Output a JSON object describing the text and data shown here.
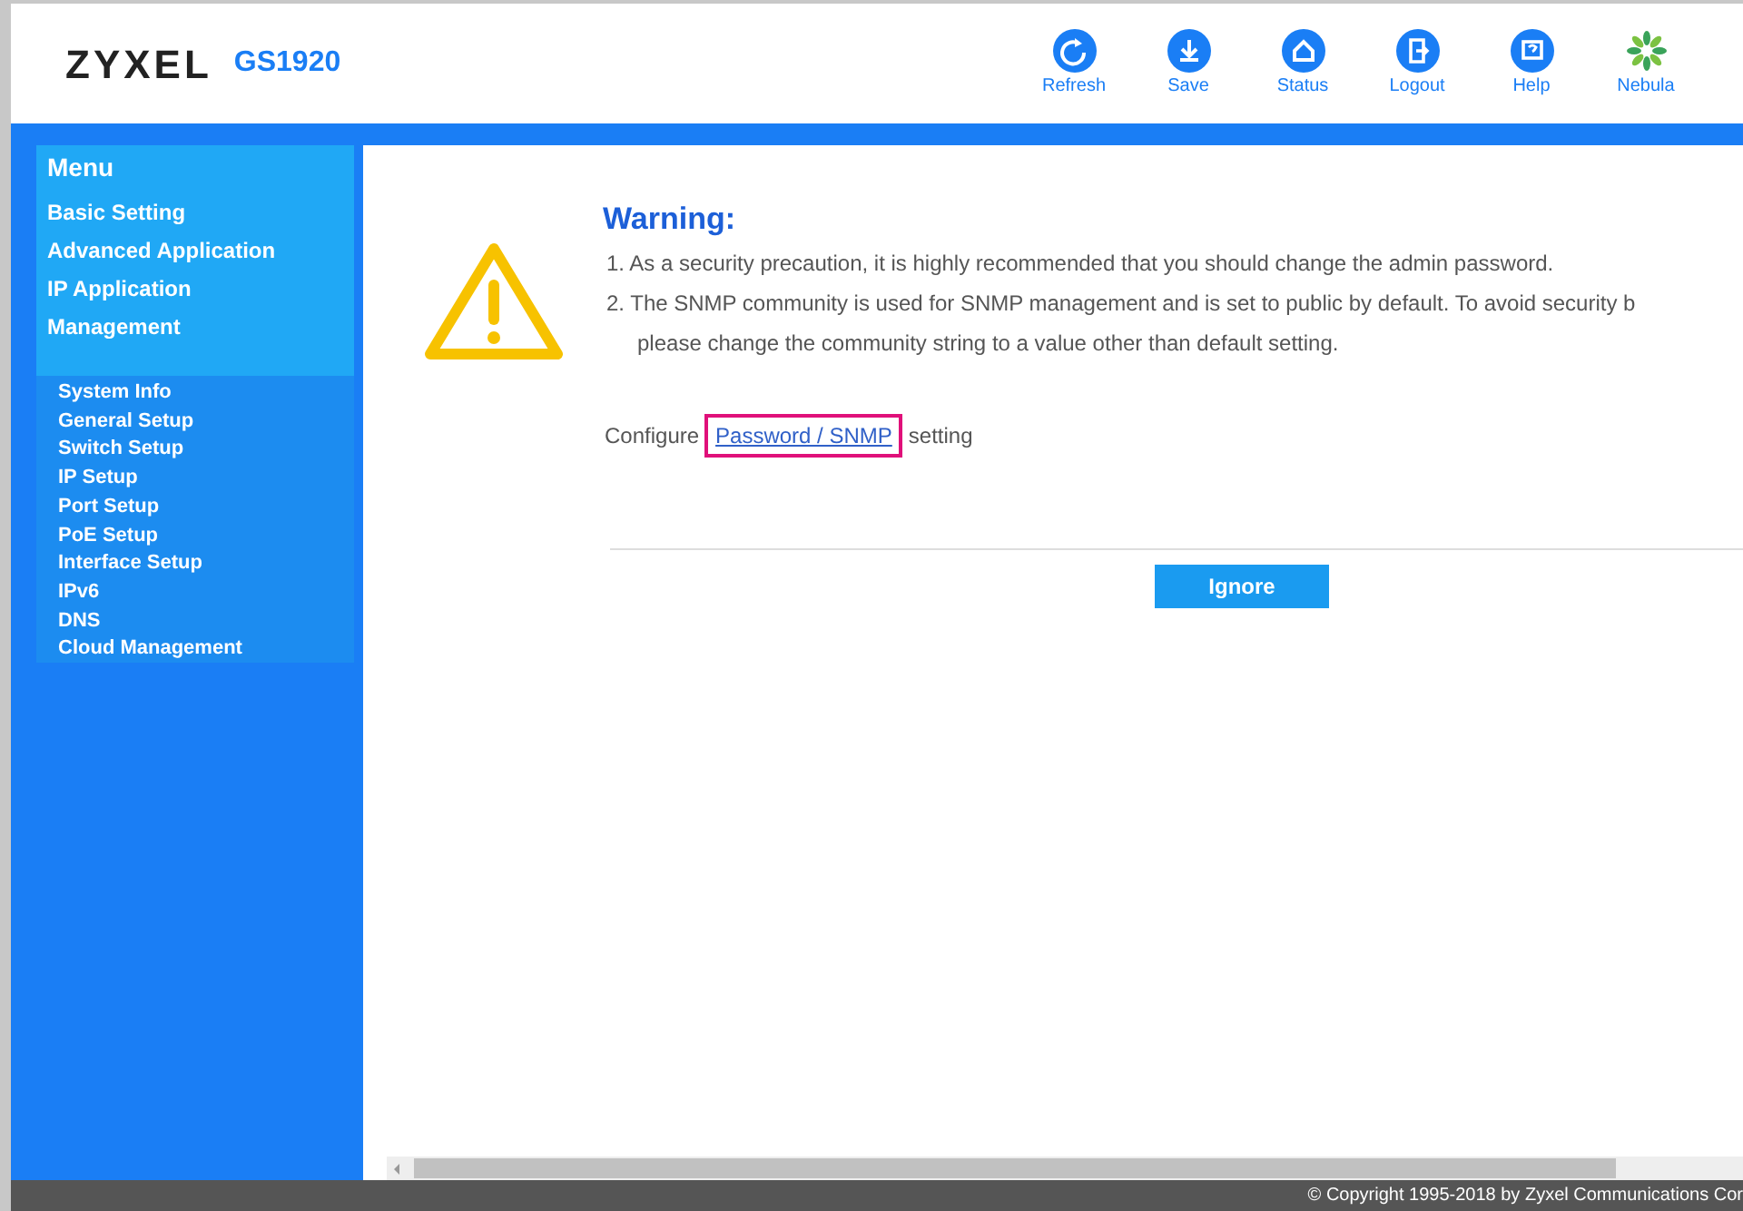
{
  "header": {
    "brand": "ZYXEL",
    "model": "GS1920"
  },
  "toolbar": [
    {
      "label": "Refresh"
    },
    {
      "label": "Save"
    },
    {
      "label": "Status"
    },
    {
      "label": "Logout"
    },
    {
      "label": "Help"
    },
    {
      "label": "Nebula"
    }
  ],
  "sidebar": {
    "title": "Menu",
    "sections": [
      {
        "label": "Basic Setting"
      },
      {
        "label": "Advanced Application"
      },
      {
        "label": "IP Application"
      },
      {
        "label": "Management"
      }
    ],
    "items": [
      {
        "label": "System Info"
      },
      {
        "label": "General Setup"
      },
      {
        "label": "Switch Setup"
      },
      {
        "label": "IP Setup"
      },
      {
        "label": "Port Setup"
      },
      {
        "label": "PoE Setup"
      },
      {
        "label": "Interface Setup"
      },
      {
        "label": "IPv6"
      },
      {
        "label": "DNS"
      },
      {
        "label": "Cloud Management"
      }
    ]
  },
  "warning": {
    "title": "Warning:",
    "lines": [
      "1. As a security precaution, it is highly recommended that you should change the admin password.",
      "2. The SNMP community is used for SNMP management and is set to public by default. To avoid security b",
      "please change the community string to a value other than default setting."
    ],
    "configure_prefix": "Configure",
    "link": {
      "label": "Password / SNMP",
      "focused": true
    },
    "configure_suffix": "setting",
    "button": "Ignore"
  },
  "footer": "© Copyright 1995-2018 by Zyxel Communications Cor"
}
